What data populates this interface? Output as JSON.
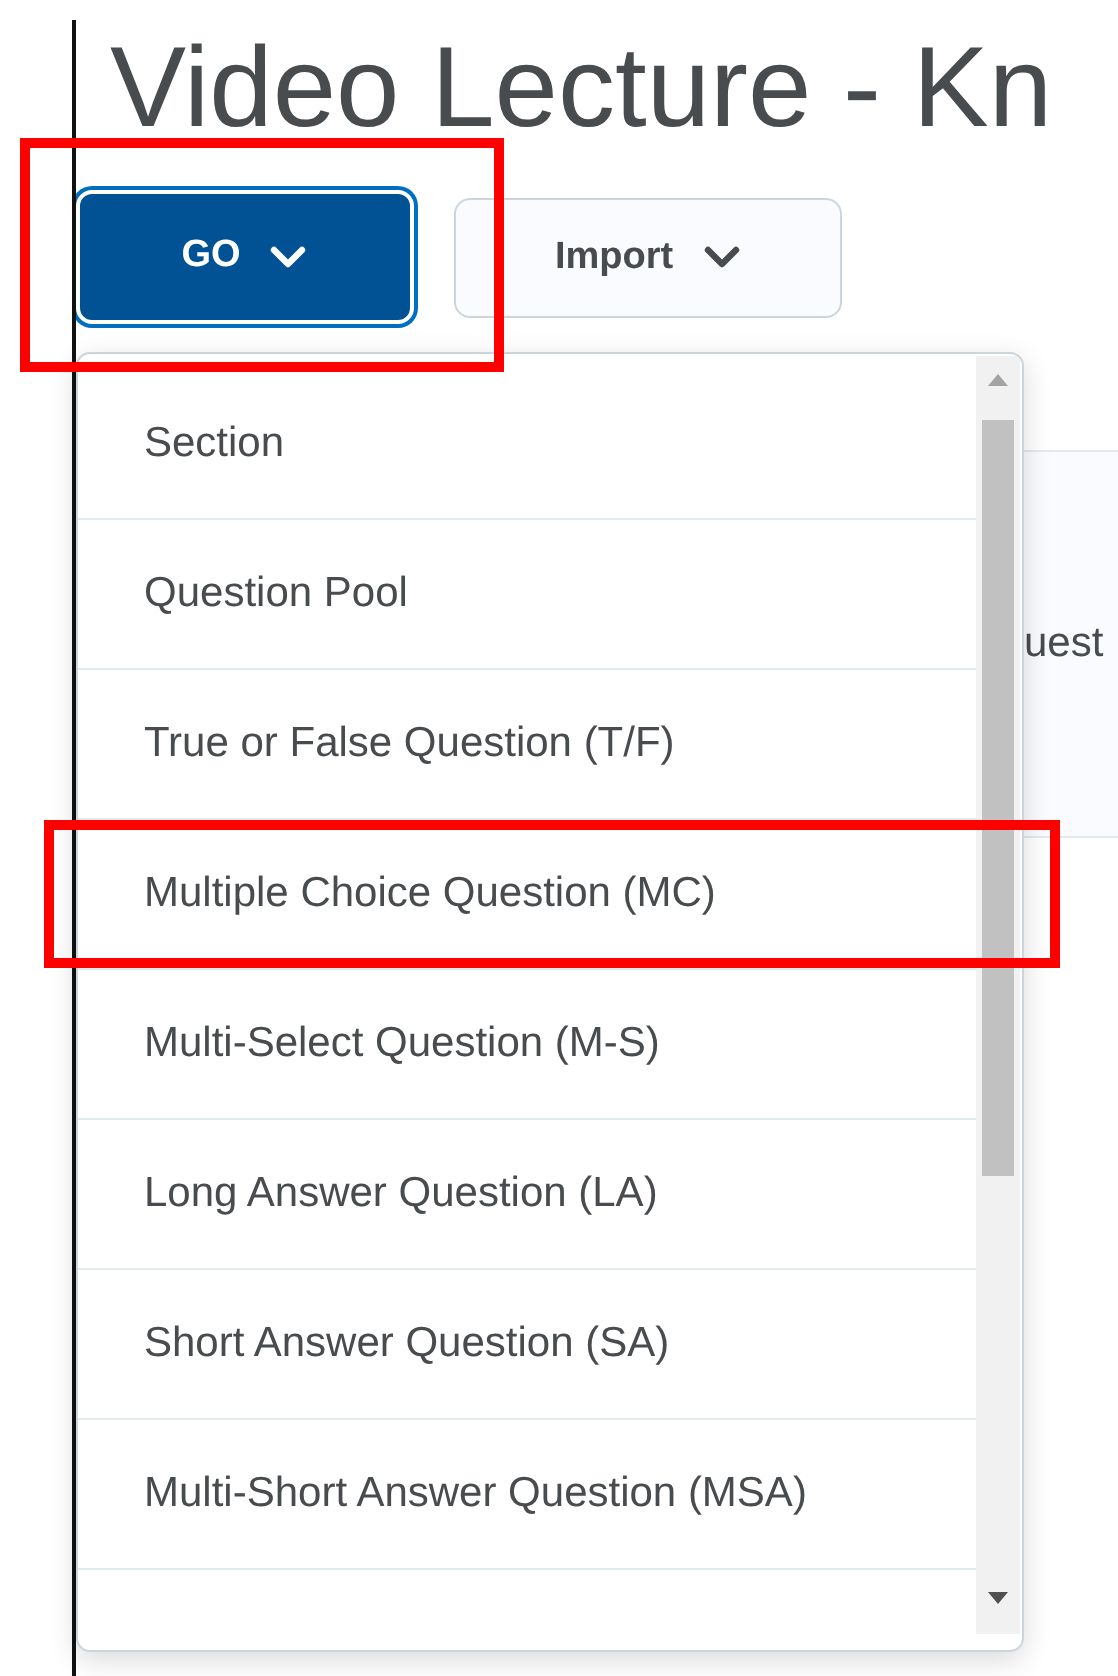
{
  "page_title": "Video Lecture - Kn",
  "buttons": [
    {
      "label": "GO",
      "kind": "primary",
      "focused": true,
      "highlighted": true
    },
    {
      "label": "Import",
      "kind": "secondary",
      "focused": false,
      "highlighted": false
    }
  ],
  "background_text": "uest",
  "menu": {
    "items": [
      {
        "label": "Section",
        "highlighted": false
      },
      {
        "label": "Question Pool",
        "highlighted": false
      },
      {
        "label": "True or False Question (T/F)",
        "highlighted": false
      },
      {
        "label": "Multiple Choice Question (MC)",
        "highlighted": true
      },
      {
        "label": "Multi-Select Question (M-S)",
        "highlighted": false
      },
      {
        "label": "Long Answer Question (LA)",
        "highlighted": false
      },
      {
        "label": "Short Answer Question (SA)",
        "highlighted": false
      },
      {
        "label": "Multi-Short Answer Question (MSA)",
        "highlighted": false
      }
    ]
  }
}
